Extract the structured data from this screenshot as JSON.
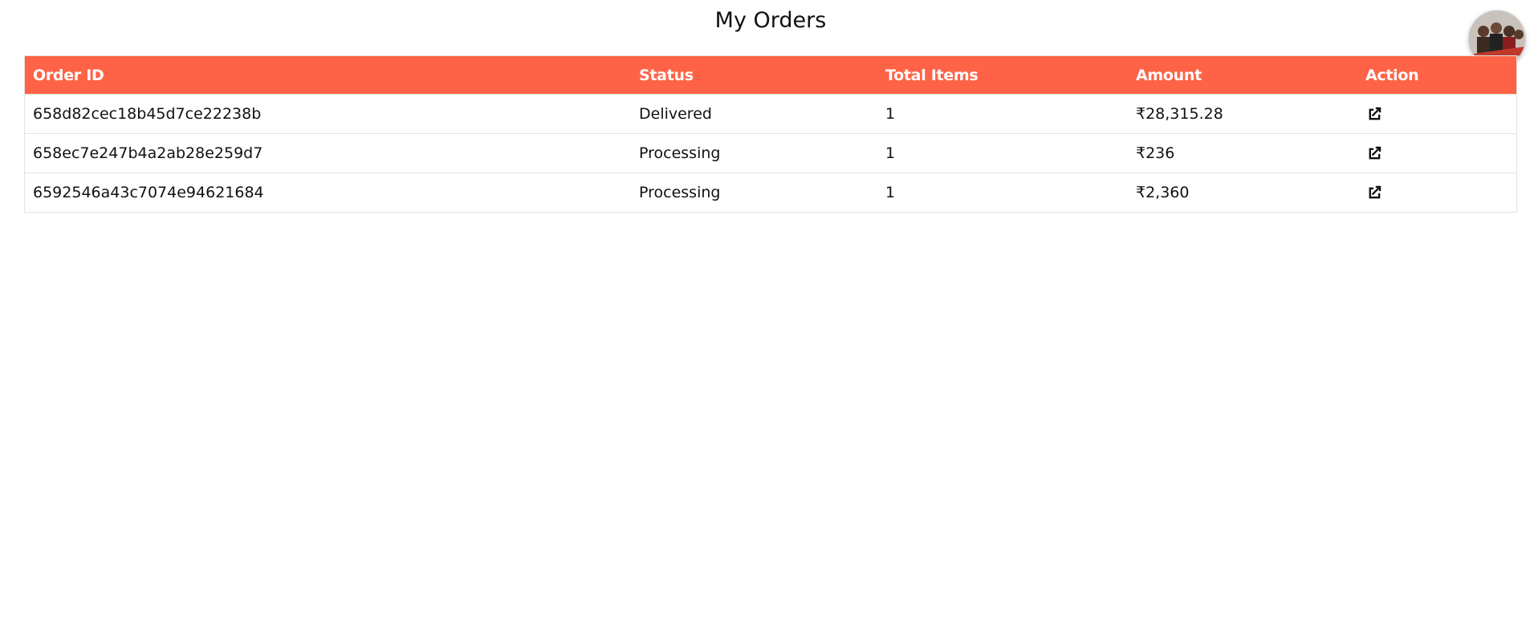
{
  "page": {
    "title": "My Orders"
  },
  "table": {
    "columns": [
      "Order ID",
      "Status",
      "Total Items",
      "Amount",
      "Action"
    ],
    "rows": [
      {
        "order_id": "658d82cec18b45d7ce22238b",
        "status": "Delivered",
        "total_items": "1",
        "amount": "₹28,315.28",
        "action_icon": "external-link-icon"
      },
      {
        "order_id": "658ec7e247b4a2ab28e259d7",
        "status": "Processing",
        "total_items": "1",
        "amount": "₹236",
        "action_icon": "external-link-icon"
      },
      {
        "order_id": "6592546a43c7074e94621684",
        "status": "Processing",
        "total_items": "1",
        "amount": "₹2,360",
        "action_icon": "external-link-icon"
      }
    ]
  },
  "colors": {
    "header_bg": "#ff6347",
    "delivered": "#22b14c",
    "processing": "#4a6ee6"
  },
  "avatar": {
    "icon": "user-avatar-photo"
  }
}
